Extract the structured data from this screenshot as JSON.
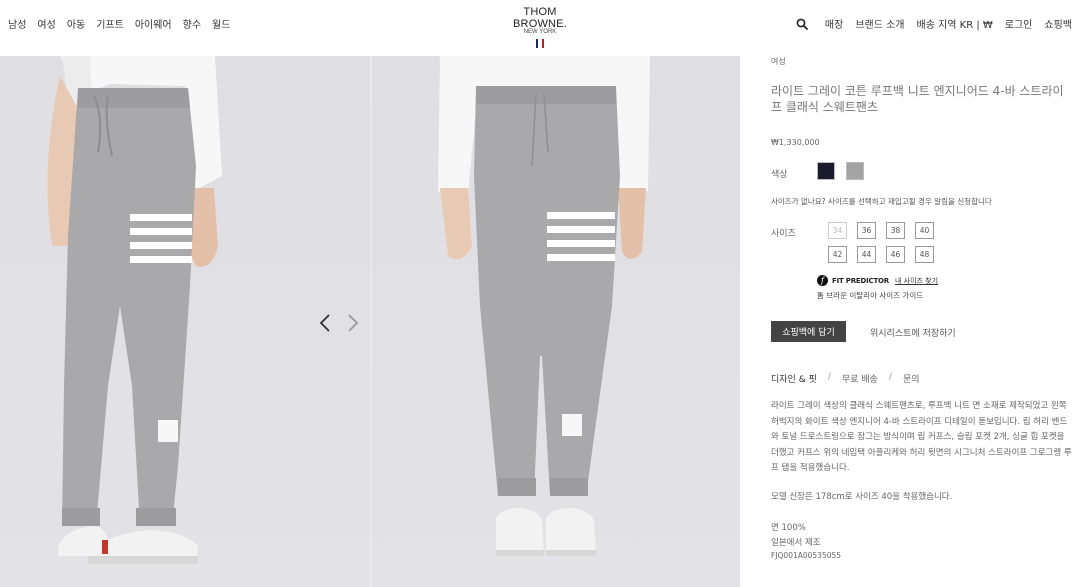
{
  "nav_left": [
    "남성",
    "여성",
    "아동",
    "기프트",
    "아이웨어",
    "향수",
    "월드"
  ],
  "logo": {
    "main": "THOM BROWNE.",
    "sub": "NEW YORK",
    "flag_colors": [
      "#1f2a5a",
      "#ffffff",
      "#b32025"
    ]
  },
  "nav_right": [
    "매장",
    "브랜드 소개",
    "배송 지역 KR | ₩",
    "로그인",
    "쇼핑백"
  ],
  "search": {
    "icon": "search-icon"
  },
  "gallery": {
    "prev_icon": "chevron-left-icon",
    "next_icon": "chevron-right-icon"
  },
  "product": {
    "category": "여성",
    "title": "라이트 그레이 코튼 루프백 니트 엔지니어드 4-바 스트라이프 클래식 스웨트팬츠",
    "price": "₩1,330,000",
    "color_label": "색상",
    "colors": [
      "#1a1c2b",
      "#a3a3a3"
    ],
    "size_notice": "사이즈가 없나요? 사이즈를 선택하고 재입고될 경우 알림을 신청합니다",
    "size_label": "사이즈",
    "sizes": [
      "34",
      "36",
      "38",
      "40",
      "42",
      "44",
      "46",
      "48"
    ],
    "fit_predictor": {
      "brand": "FIT PREDICTOR",
      "link": "내 사이즈 찾기"
    },
    "size_guide": "톰 브라운 이탈리아 사이즈 가이드",
    "add_to_bag": "쇼핑백에 담기",
    "wishlist": "위시리스트에 저장하기",
    "tabs": [
      "디자인 & 핏",
      "무료 배송",
      "문의"
    ],
    "description": "라이트 그레이 색상의 클래식 스웨트팬츠로, 루프백 니트 면 소재로 제작되었고 왼쪽 허벅지의 화이트 색상 엔지니어 4-바 스트라이프 디테일이 돋보입니다. 립 허리 밴드와 토널 드로스트링으로 잠그는 방식이며 립 커프스, 슬립 포켓 2개, 싱글 힙 포켓을 더했고 커프스 위의 네임택 아플리케와 허리 뒷면의 시그니처 스트라이프 그로그랭 루프 탭을 적용했습니다.",
    "model_info": "모델 신장은 178cm로 사이즈 40을 착용했습니다.",
    "material": "면 100%",
    "origin": "일본에서 제조",
    "sku": "FJQ001A00535055"
  }
}
